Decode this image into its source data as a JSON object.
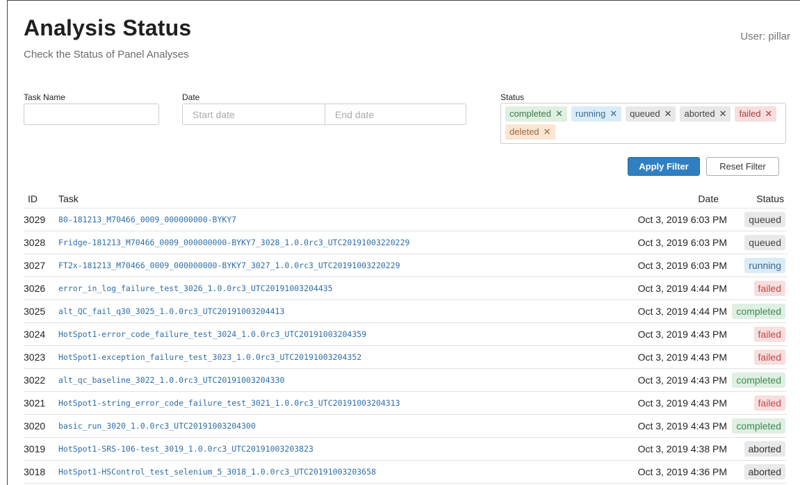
{
  "header": {
    "title": "Analysis Status",
    "subtitle": "Check the Status of Panel Analyses",
    "user": "User: pillar"
  },
  "filters": {
    "task_label": "Task Name",
    "date_label": "Date",
    "start_placeholder": "Start date",
    "end_placeholder": "End date",
    "status_label": "Status",
    "status_tags": [
      "completed",
      "running",
      "queued",
      "aborted",
      "failed",
      "deleted"
    ],
    "apply_label": "Apply Filter",
    "reset_label": "Reset Filter"
  },
  "table": {
    "columns": {
      "id": "ID",
      "task": "Task",
      "date": "Date",
      "status": "Status"
    },
    "rows": [
      {
        "id": "3029",
        "task": "80-181213_M70466_0009_000000000-BYKY7",
        "date": "Oct 3, 2019 6:03 PM",
        "status": "queued"
      },
      {
        "id": "3028",
        "task": "Fridge-181213_M70466_0009_000000000-BYKY7_3028_1.0.0rc3_UTC20191003220229",
        "date": "Oct 3, 2019 6:03 PM",
        "status": "queued"
      },
      {
        "id": "3027",
        "task": "FT2x-181213_M70466_0009_000000000-BYKY7_3027_1.0.0rc3_UTC20191003220229",
        "date": "Oct 3, 2019 6:03 PM",
        "status": "running"
      },
      {
        "id": "3026",
        "task": "error_in_log_failure_test_3026_1.0.0rc3_UTC20191003204435",
        "date": "Oct 3, 2019 4:44 PM",
        "status": "failed"
      },
      {
        "id": "3025",
        "task": "alt_QC_fail_q30_3025_1.0.0rc3_UTC20191003204413",
        "date": "Oct 3, 2019 4:44 PM",
        "status": "completed"
      },
      {
        "id": "3024",
        "task": "HotSpot1-error_code_failure_test_3024_1.0.0rc3_UTC20191003204359",
        "date": "Oct 3, 2019 4:43 PM",
        "status": "failed"
      },
      {
        "id": "3023",
        "task": "HotSpot1-exception_failure_test_3023_1.0.0rc3_UTC20191003204352",
        "date": "Oct 3, 2019 4:43 PM",
        "status": "failed"
      },
      {
        "id": "3022",
        "task": "alt_qc_baseline_3022_1.0.0rc3_UTC20191003204330",
        "date": "Oct 3, 2019 4:43 PM",
        "status": "completed"
      },
      {
        "id": "3021",
        "task": "HotSpot1-string_error_code_failure_test_3021_1.0.0rc3_UTC20191003204313",
        "date": "Oct 3, 2019 4:43 PM",
        "status": "failed"
      },
      {
        "id": "3020",
        "task": "basic_run_3020_1.0.0rc3_UTC20191003204300",
        "date": "Oct 3, 2019 4:43 PM",
        "status": "completed"
      },
      {
        "id": "3019",
        "task": "HotSpot1-SRS-106-test_3019_1.0.0rc3_UTC20191003203823",
        "date": "Oct 3, 2019 4:38 PM",
        "status": "aborted"
      },
      {
        "id": "3018",
        "task": "HotSpot1-HSControl_test_selenium_5_3018_1.0.0rc3_UTC20191003203658",
        "date": "Oct 3, 2019 4:36 PM",
        "status": "aborted"
      }
    ]
  }
}
